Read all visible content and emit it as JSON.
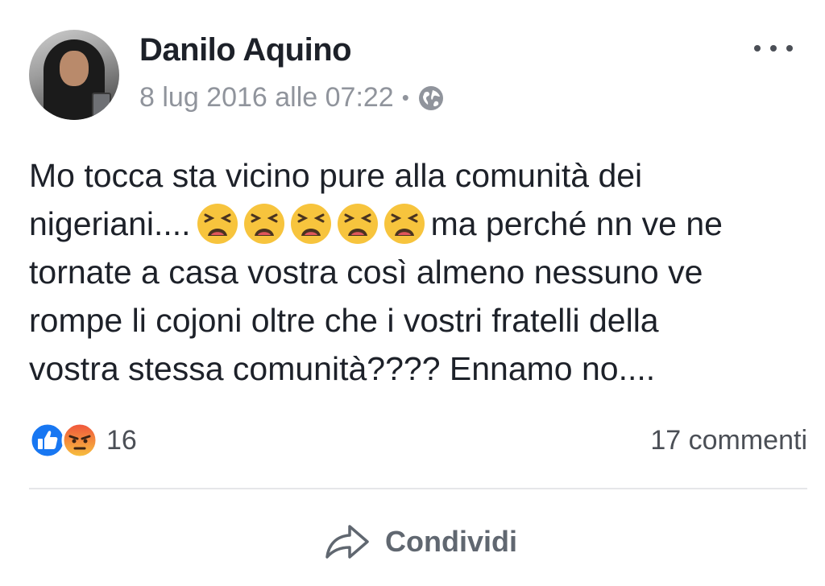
{
  "post": {
    "author": "Danilo Aquino",
    "timestamp": "8 lug 2016 alle 07:22",
    "separator": "•",
    "privacy_icon": "globe-icon",
    "more_icon": "more-options-icon",
    "text": {
      "line1": "Mo tocca sta vicino pure alla comunità dei",
      "line2_before": "nigeriani....",
      "line2_emoji": "tired-face-emoji x5",
      "line2_after": "ma perché nn ve ne",
      "line3": "tornate a casa vostra così almeno nessuno ve",
      "line4": "rompe li cojoni oltre che i vostri fratelli della",
      "line5": "vostra stessa comunità???? Ennamo no...."
    },
    "reactions": {
      "icons": [
        "like-icon",
        "angry-icon"
      ],
      "count": "16",
      "like_color": "#1877f2",
      "angry_color": "#f5a623"
    },
    "comments_label": "17 commenti",
    "share_label": "Condividi"
  }
}
